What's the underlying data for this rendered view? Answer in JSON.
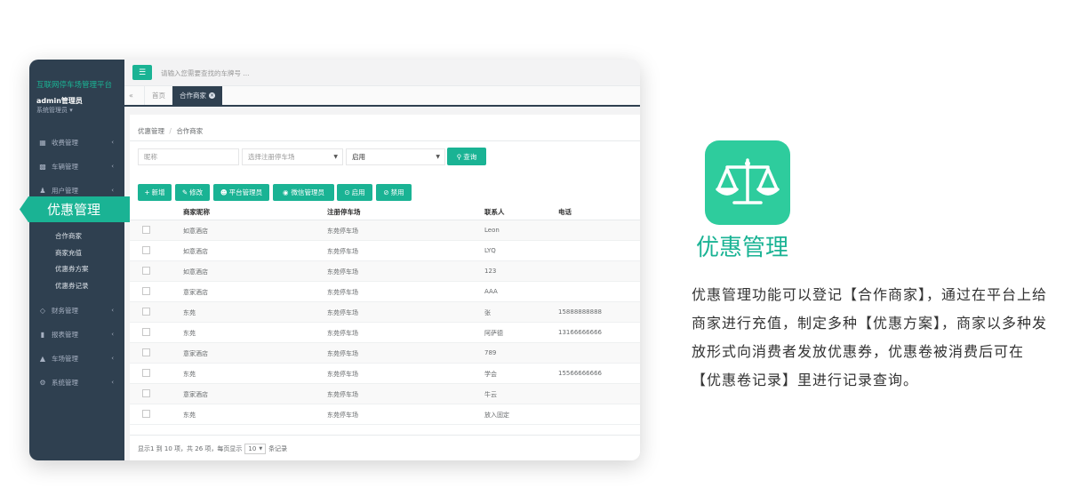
{
  "sidebar": {
    "brand": "互联网停车场管理平台",
    "admin_name": "admin管理员",
    "admin_role": "系统管理员 ▾",
    "items": [
      {
        "label": "收费管理",
        "icon": "grid-icon"
      },
      {
        "label": "车辆管理",
        "icon": "car-icon"
      },
      {
        "label": "用户管理",
        "icon": "users-icon"
      },
      {
        "label": "财务管理",
        "icon": "diamond-icon"
      },
      {
        "label": "报表管理",
        "icon": "bar-chart-icon"
      },
      {
        "label": "车场管理",
        "icon": "road-icon"
      },
      {
        "label": "系统管理",
        "icon": "gears-icon"
      }
    ],
    "active": "优惠管理",
    "sub_items": [
      "合作商家",
      "商家充值",
      "优惠券方案",
      "优惠券记录"
    ]
  },
  "topbar": {
    "search_placeholder": "请输入您需要查找的车牌号 ..."
  },
  "tabs": {
    "home": "首页",
    "current": "合作商家"
  },
  "breadcrumb": {
    "parent": "优惠管理",
    "separator": "/",
    "current": "合作商家"
  },
  "filters": {
    "nickname_placeholder": "昵称",
    "parking_placeholder": "选择注册停车场",
    "status_value": "启用",
    "search_label": "查询"
  },
  "toolbar": {
    "add": "新增",
    "edit": "修改",
    "platform_admin": "平台管理员",
    "wechat_admin": "微信管理员",
    "enable": "启用",
    "disable": "禁用"
  },
  "table": {
    "columns": [
      "商家昵称",
      "注册停车场",
      "联系人",
      "电话"
    ],
    "rows": [
      [
        "如意酒店",
        "东苑停车场",
        "Leon",
        ""
      ],
      [
        "如意酒店",
        "东苑停车场",
        "LYQ",
        ""
      ],
      [
        "如意酒店",
        "东苑停车场",
        "123",
        ""
      ],
      [
        "意家酒店",
        "东苑停车场",
        "AAA",
        ""
      ],
      [
        "东苑",
        "东苑停车场",
        "张",
        "15888888888"
      ],
      [
        "东苑",
        "东苑停车场",
        "阿萨德",
        "13166666666"
      ],
      [
        "意家酒店",
        "东苑停车场",
        "789",
        ""
      ],
      [
        "东苑",
        "东苑停车场",
        "学会",
        "15566666666"
      ],
      [
        "意家酒店",
        "东苑停车场",
        "牛云",
        ""
      ],
      [
        "东苑",
        "东苑停车场",
        "放入固定",
        ""
      ]
    ]
  },
  "pager": {
    "summary": "显示1 到 10 项，共 26 项，每页显示",
    "page_size": "10",
    "suffix": "条记录"
  },
  "feature": {
    "title": "优惠管理",
    "description": "优惠管理功能可以登记【合作商家】，通过在平台上给商家进行充值，制定多种【优惠方案】，商家以多种发放形式向消费者发放优惠券，优惠卷被消费后可在【优惠卷记录】里进行记录查询。",
    "accent_color": "#1ab394",
    "logo_color": "#2ecc9d",
    "logo_icon": "balance-scale-icon"
  }
}
